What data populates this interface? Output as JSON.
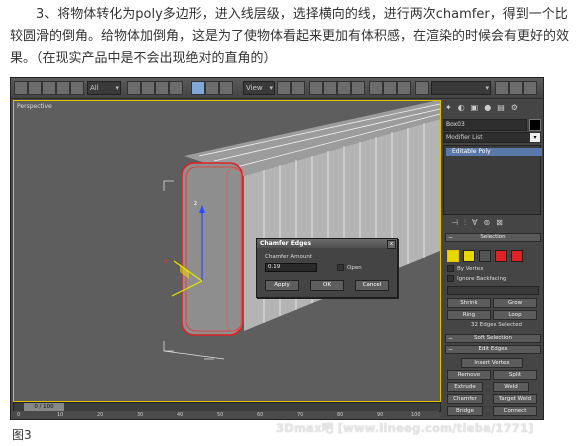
{
  "article": {
    "paragraph": "3、将物体转化为poly多边形，进入线层级，选择横向的线，进行两次chamfer，得到一个比较圆滑的倒角。给物体加倒角，这是为了使物体看起来更加有体积感，在渲染的时候会有更好的效果。（在现实产品中是不会出现绝对的直角的）",
    "caption": "图3",
    "watermark": "3Dmax吧 [www.lineeg.com/tieba/1771]"
  },
  "toolbar": {
    "filter_combo": "All",
    "view_combo": "View"
  },
  "viewport": {
    "label": "Perspective",
    "border_color": "#e0c200"
  },
  "command_panel": {
    "object_name": "Box03",
    "modifier_list": "Modifier List",
    "stack_item": "Editable Poly",
    "selection_rollout": "Selection",
    "by_vertex": "By Vertex",
    "ignore_backfacing": "Ignore Backfacing",
    "shrink": "Shrink",
    "grow": "Grow",
    "ring": "Ring",
    "loop": "Loop",
    "status": "32 Edges Selected",
    "soft_selection": "Soft Selection",
    "edit_edges": "Edit Edges",
    "insert_vertex": "Insert Vertex",
    "remove": "Remove",
    "split": "Split",
    "extrude": "Extrude",
    "weld": "Weld",
    "chamfer": "Chamfer",
    "target_weld": "Target Weld",
    "bridge": "Bridge",
    "connect": "Connect"
  },
  "dialog": {
    "title": "Chamfer Edges",
    "amount_label": "Chamfer Amount",
    "amount_value": "0.19",
    "open_label": "Open",
    "apply": "Apply",
    "ok": "OK",
    "cancel": "Cancel"
  },
  "timeline": {
    "frame": "0 / 100"
  },
  "ruler_ticks": [
    "0",
    "10",
    "20",
    "30",
    "40",
    "50",
    "60",
    "70",
    "80",
    "90",
    "100"
  ]
}
